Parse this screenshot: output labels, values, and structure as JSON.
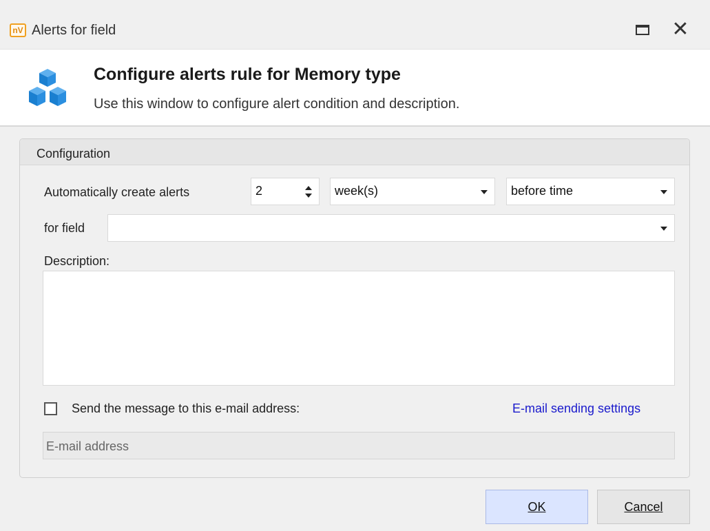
{
  "window": {
    "logo_text": "nV",
    "title": "Alerts for field"
  },
  "header": {
    "title": "Configure alerts rule for Memory type",
    "subtitle": "Use this window to configure alert condition and description.",
    "icon": "cubes-icon"
  },
  "config": {
    "group_title": "Configuration",
    "auto_label": "Automatically create alerts",
    "count_value": "2",
    "period_value": "week(s)",
    "relation_value": "before time",
    "field_label": "for field",
    "field_value": "",
    "description_label": "Description:",
    "description_value": "",
    "send_email_label": "Send the message to this e-mail address:",
    "send_email_checked": false,
    "email_settings_link": "E-mail sending settings",
    "email_placeholder": "E-mail address"
  },
  "buttons": {
    "ok": "OK",
    "cancel": "Cancel"
  },
  "colors": {
    "accent_blue": "#1e88d6",
    "link": "#1a1acc",
    "ok_bg": "#dbe5ff"
  }
}
